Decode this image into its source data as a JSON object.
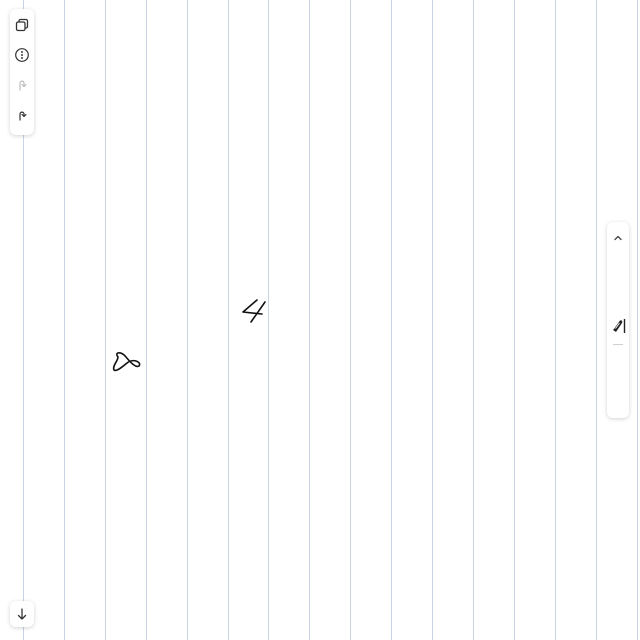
{
  "canvas": {
    "background": "#ffffff",
    "rule_color": "#c9d3e4",
    "ink_color": "#111111"
  },
  "toolbar": {
    "icons": [
      "pages-icon",
      "more-options-icon",
      "redo-icon",
      "undo-icon"
    ]
  },
  "right_panel": {
    "icons": [
      "collapse-up-icon",
      "pen-tool-icon"
    ]
  },
  "bottom": {
    "icon": "scroll-down-icon"
  },
  "strokes": {
    "items": [
      "handwritten-8",
      "handwritten-4"
    ]
  }
}
